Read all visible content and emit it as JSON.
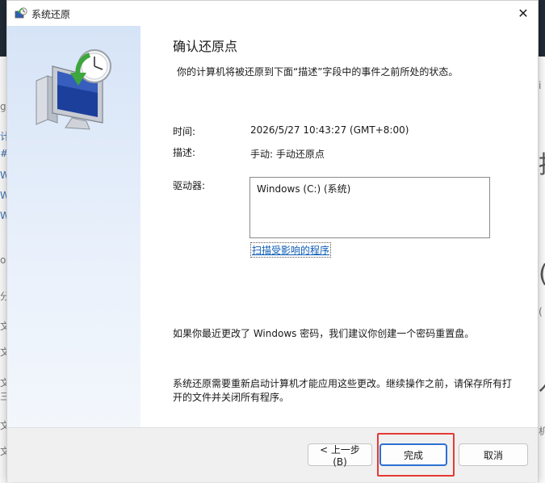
{
  "background": {
    "left_glyphs": [
      "g",
      "计",
      "#",
      "W",
      "W",
      "W",
      "o",
      "分",
      "文",
      "文",
      "文",
      "三",
      "文",
      "文"
    ],
    "right_glyphs": [
      "挡",
      "i",
      "(",
      "(",
      "亻",
      "机"
    ]
  },
  "window": {
    "title": "系统还原",
    "close_glyph": "✕"
  },
  "content": {
    "heading": "确认还原点",
    "description": "你的计算机将被还原到下面“描述”字段中的事件之前所处的状态。",
    "time_label": "时间:",
    "time_value": "2026/5/27 10:43:27 (GMT+8:00)",
    "desc_label": "描述:",
    "desc_value": "手动: 手动还原点",
    "drives_label": "驱动器:",
    "drives": [
      "Windows (C:) (系统)"
    ],
    "scan_link": "扫描受影响的程序",
    "password_note": "如果你最近更改了 Windows 密码，我们建议你创建一个密码重置盘。",
    "restart_note": "系统还原需要重新启动计算机才能应用这些更改。继续操作之前，请保存所有打开的文件并关闭所有程序。"
  },
  "buttons": {
    "back": "< 上一步(B)",
    "finish": "完成",
    "cancel": "取消"
  },
  "colors": {
    "highlight": "#e53935",
    "focus_border": "#2b6fd3",
    "link": "#0b5bb5"
  }
}
